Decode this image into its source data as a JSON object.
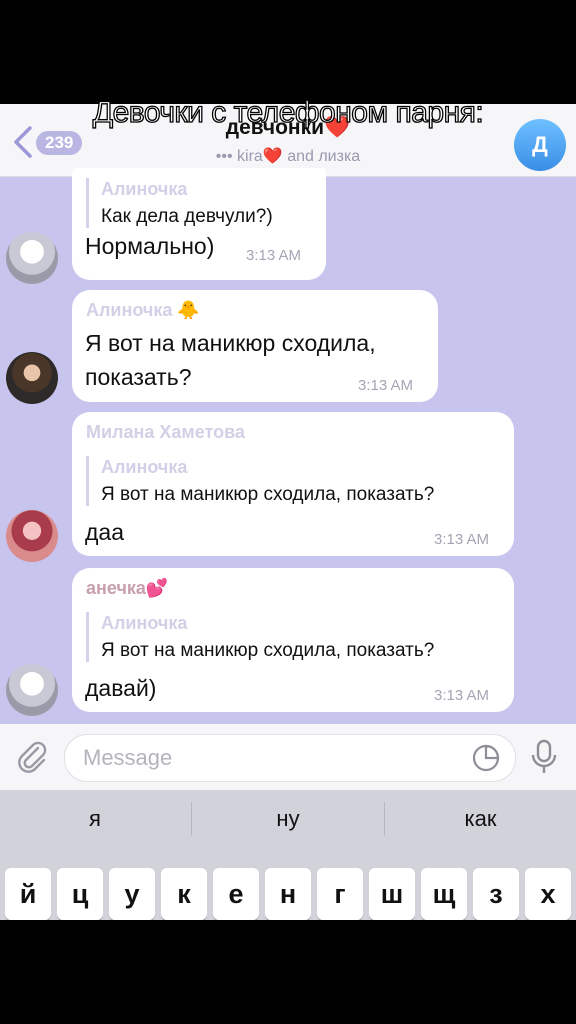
{
  "overlay_caption": "Девочки с телефоном парня:",
  "header": {
    "unread_count": "239",
    "title": "девчонки❤️",
    "members_line": "••• kira❤️ and лизка",
    "avatar_letter": "Д"
  },
  "messages": [
    {
      "reply_author": "Алиночка",
      "reply_text": "Как дела девчули?)",
      "text": "Нормально)",
      "time": "3:13 AM"
    },
    {
      "sender": "Алиночка 🐥",
      "text_line1": "Я вот на маникюр сходила,",
      "text_line2": "показать?",
      "time": "3:13 AM"
    },
    {
      "sender": "Милана Хаметова",
      "reply_author": "Алиночка",
      "reply_text": "Я вот на маникюр сходила, показать?",
      "text": "даа",
      "time": "3:13 AM"
    },
    {
      "sender": "анечка💕",
      "reply_author": "Алиночка",
      "reply_text": "Я вот на маникюр сходила, показать?",
      "text": "давай)",
      "time": "3:13 AM"
    }
  ],
  "input": {
    "placeholder": "Message"
  },
  "suggestions": [
    "я",
    "ну",
    "как"
  ],
  "keys": [
    "й",
    "ц",
    "у",
    "к",
    "е",
    "н",
    "г",
    "ш",
    "щ",
    "з",
    "х"
  ],
  "colors": {
    "chat_background": "#c7c4ee",
    "accent": "#3a8ee6",
    "bubble": "#ffffff"
  },
  "icons": [
    "back-chevron-icon",
    "attach-icon",
    "sticker-icon",
    "microphone-icon"
  ]
}
